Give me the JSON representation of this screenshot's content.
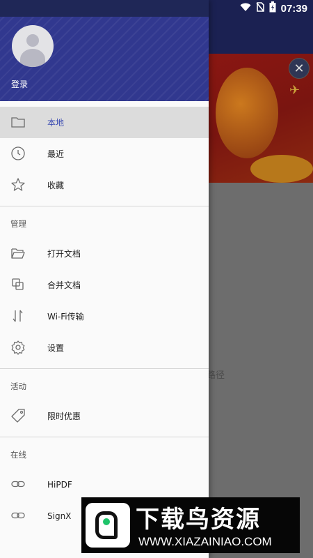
{
  "status_bar": {
    "time": "07:39"
  },
  "background": {
    "hint_text": "路径",
    "close_glyph": "✕"
  },
  "drawer": {
    "header": {
      "login_label": "登录"
    },
    "primary_items": [
      {
        "label": "本地",
        "icon": "folder-icon",
        "active": true
      },
      {
        "label": "最近",
        "icon": "clock-icon",
        "active": false
      },
      {
        "label": "收藏",
        "icon": "star-icon",
        "active": false
      }
    ],
    "sections": [
      {
        "title": "管理",
        "items": [
          {
            "label": "打开文档",
            "icon": "open-folder-icon"
          },
          {
            "label": "合并文档",
            "icon": "merge-icon"
          },
          {
            "label": "Wi-Fi传输",
            "icon": "transfer-icon"
          },
          {
            "label": "设置",
            "icon": "gear-icon"
          }
        ]
      },
      {
        "title": "活动",
        "items": [
          {
            "label": "限时优惠",
            "icon": "tag-icon"
          }
        ]
      },
      {
        "title": "在线",
        "items": [
          {
            "label": "HiPDF",
            "icon": "link-icon"
          },
          {
            "label": "SignX",
            "icon": "link-icon"
          }
        ]
      }
    ]
  },
  "watermark": {
    "title": "下载鸟资源",
    "url": "WWW.XIAZAINIAO.COM"
  },
  "colors": {
    "header": "#31388f",
    "accent": "#3b4bb2",
    "active_bg": "#dcdcdc"
  }
}
